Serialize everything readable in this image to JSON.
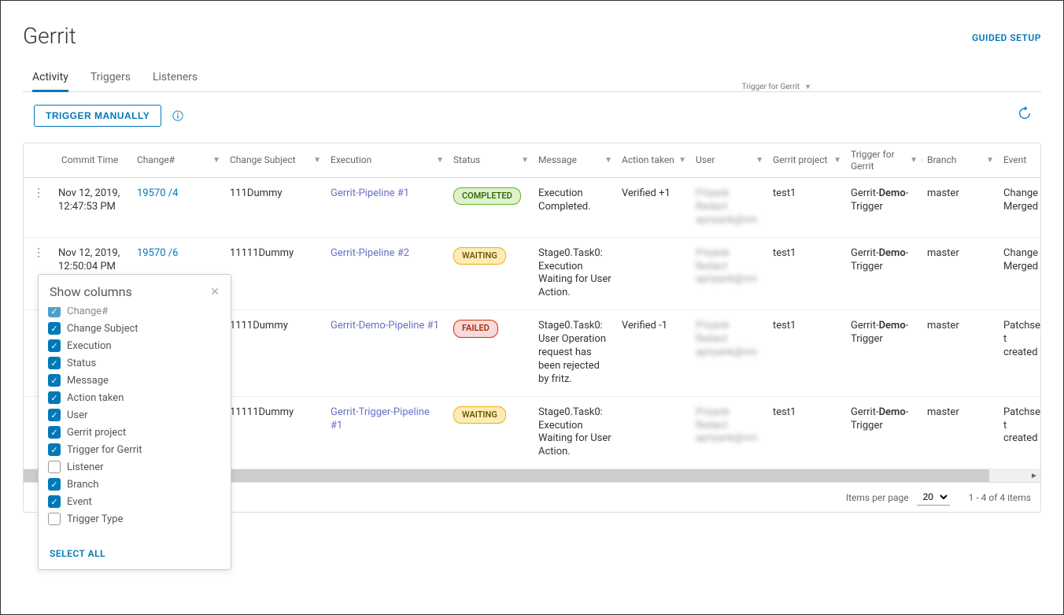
{
  "title": "Gerrit",
  "guided_setup": "GUIDED SETUP",
  "tabs": {
    "activity": "Activity",
    "triggers": "Triggers",
    "listeners": "Listeners"
  },
  "toolbar": {
    "trigger_btn": "TRIGGER MANUALLY",
    "tooltip": "Trigger for Gerrit"
  },
  "columns": {
    "commit": "Commit Time",
    "change": "Change#",
    "subject": "Change Subject",
    "exec": "Execution",
    "status": "Status",
    "msg": "Message",
    "action": "Action taken",
    "user": "User",
    "project": "Gerrit project",
    "trigger": "Trigger for Gerrit",
    "branch": "Branch",
    "event": "Event"
  },
  "status": {
    "completed": "COMPLETED",
    "waiting": "WAITING",
    "failed": "FAILED"
  },
  "rows": [
    {
      "commit": "Nov 12, 2019, 12:47:53 PM",
      "change": "19570 /4",
      "subject": "111Dummy",
      "exec": "Gerrit-Pipeline #1",
      "status": "completed",
      "msg": "Execution Completed.",
      "action": "Verified +1",
      "user_name": "Priyank Redact",
      "user_email": "apriyank@vm",
      "project": "test1",
      "trigger_pre": "Gerrit-",
      "trigger_hl": "Demo",
      "trigger_post": "-Trigger",
      "branch": "master",
      "event": "Change Merged"
    },
    {
      "commit": "Nov 12, 2019, 12:50:04 PM",
      "change": "19570 /6",
      "subject": "11111Dummy",
      "exec": "Gerrit-Pipeline #2",
      "status": "waiting",
      "msg": "Stage0.Task0: Execution Waiting for User Action.",
      "action": "",
      "user_name": "Priyank Redact",
      "user_email": "apriyank@vm",
      "project": "test1",
      "trigger_pre": "Gerrit-",
      "trigger_hl": "Demo",
      "trigger_post": "-Trigger",
      "branch": "master",
      "event": "Change Merged"
    },
    {
      "commit": "",
      "change": "",
      "subject": "1111Dummy",
      "exec": "Gerrit-Demo-Pipeline #1",
      "status": "failed",
      "msg": "Stage0.Task0: User Operation request has been rejected by fritz.",
      "action": "Verified -1",
      "user_name": "Priyank Redact",
      "user_email": "apriyank@vm",
      "project": "test1",
      "trigger_pre": "Gerrit-",
      "trigger_hl": "Demo",
      "trigger_post": "-Trigger",
      "branch": "master",
      "event": "Patchset created"
    },
    {
      "commit": "",
      "change": "",
      "subject": "11111Dummy",
      "exec": "Gerrit-Trigger-Pipeline #1",
      "status": "waiting",
      "msg": "Stage0.Task0: Execution Waiting for User Action.",
      "action": "",
      "user_name": "Priyank Redact",
      "user_email": "apriyank@vm",
      "project": "test1",
      "trigger_pre": "Gerrit-",
      "trigger_hl": "Demo",
      "trigger_post": "-Trigger",
      "branch": "master",
      "event": "Patchset created"
    }
  ],
  "popover": {
    "title": "Show columns",
    "select_all": "SELECT ALL",
    "items": [
      {
        "label": "Change#",
        "checked": true,
        "partial": true
      },
      {
        "label": "Change Subject",
        "checked": true
      },
      {
        "label": "Execution",
        "checked": true
      },
      {
        "label": "Status",
        "checked": true
      },
      {
        "label": "Message",
        "checked": true
      },
      {
        "label": "Action taken",
        "checked": true
      },
      {
        "label": "User",
        "checked": true
      },
      {
        "label": "Gerrit project",
        "checked": true
      },
      {
        "label": "Trigger for Gerrit",
        "checked": true
      },
      {
        "label": "Listener",
        "checked": false
      },
      {
        "label": "Branch",
        "checked": true
      },
      {
        "label": "Event",
        "checked": true
      },
      {
        "label": "Trigger Type",
        "checked": false
      }
    ]
  },
  "footer": {
    "items_per_page": "Items per page",
    "page_size": "20",
    "count": "1 - 4 of 4 items"
  }
}
